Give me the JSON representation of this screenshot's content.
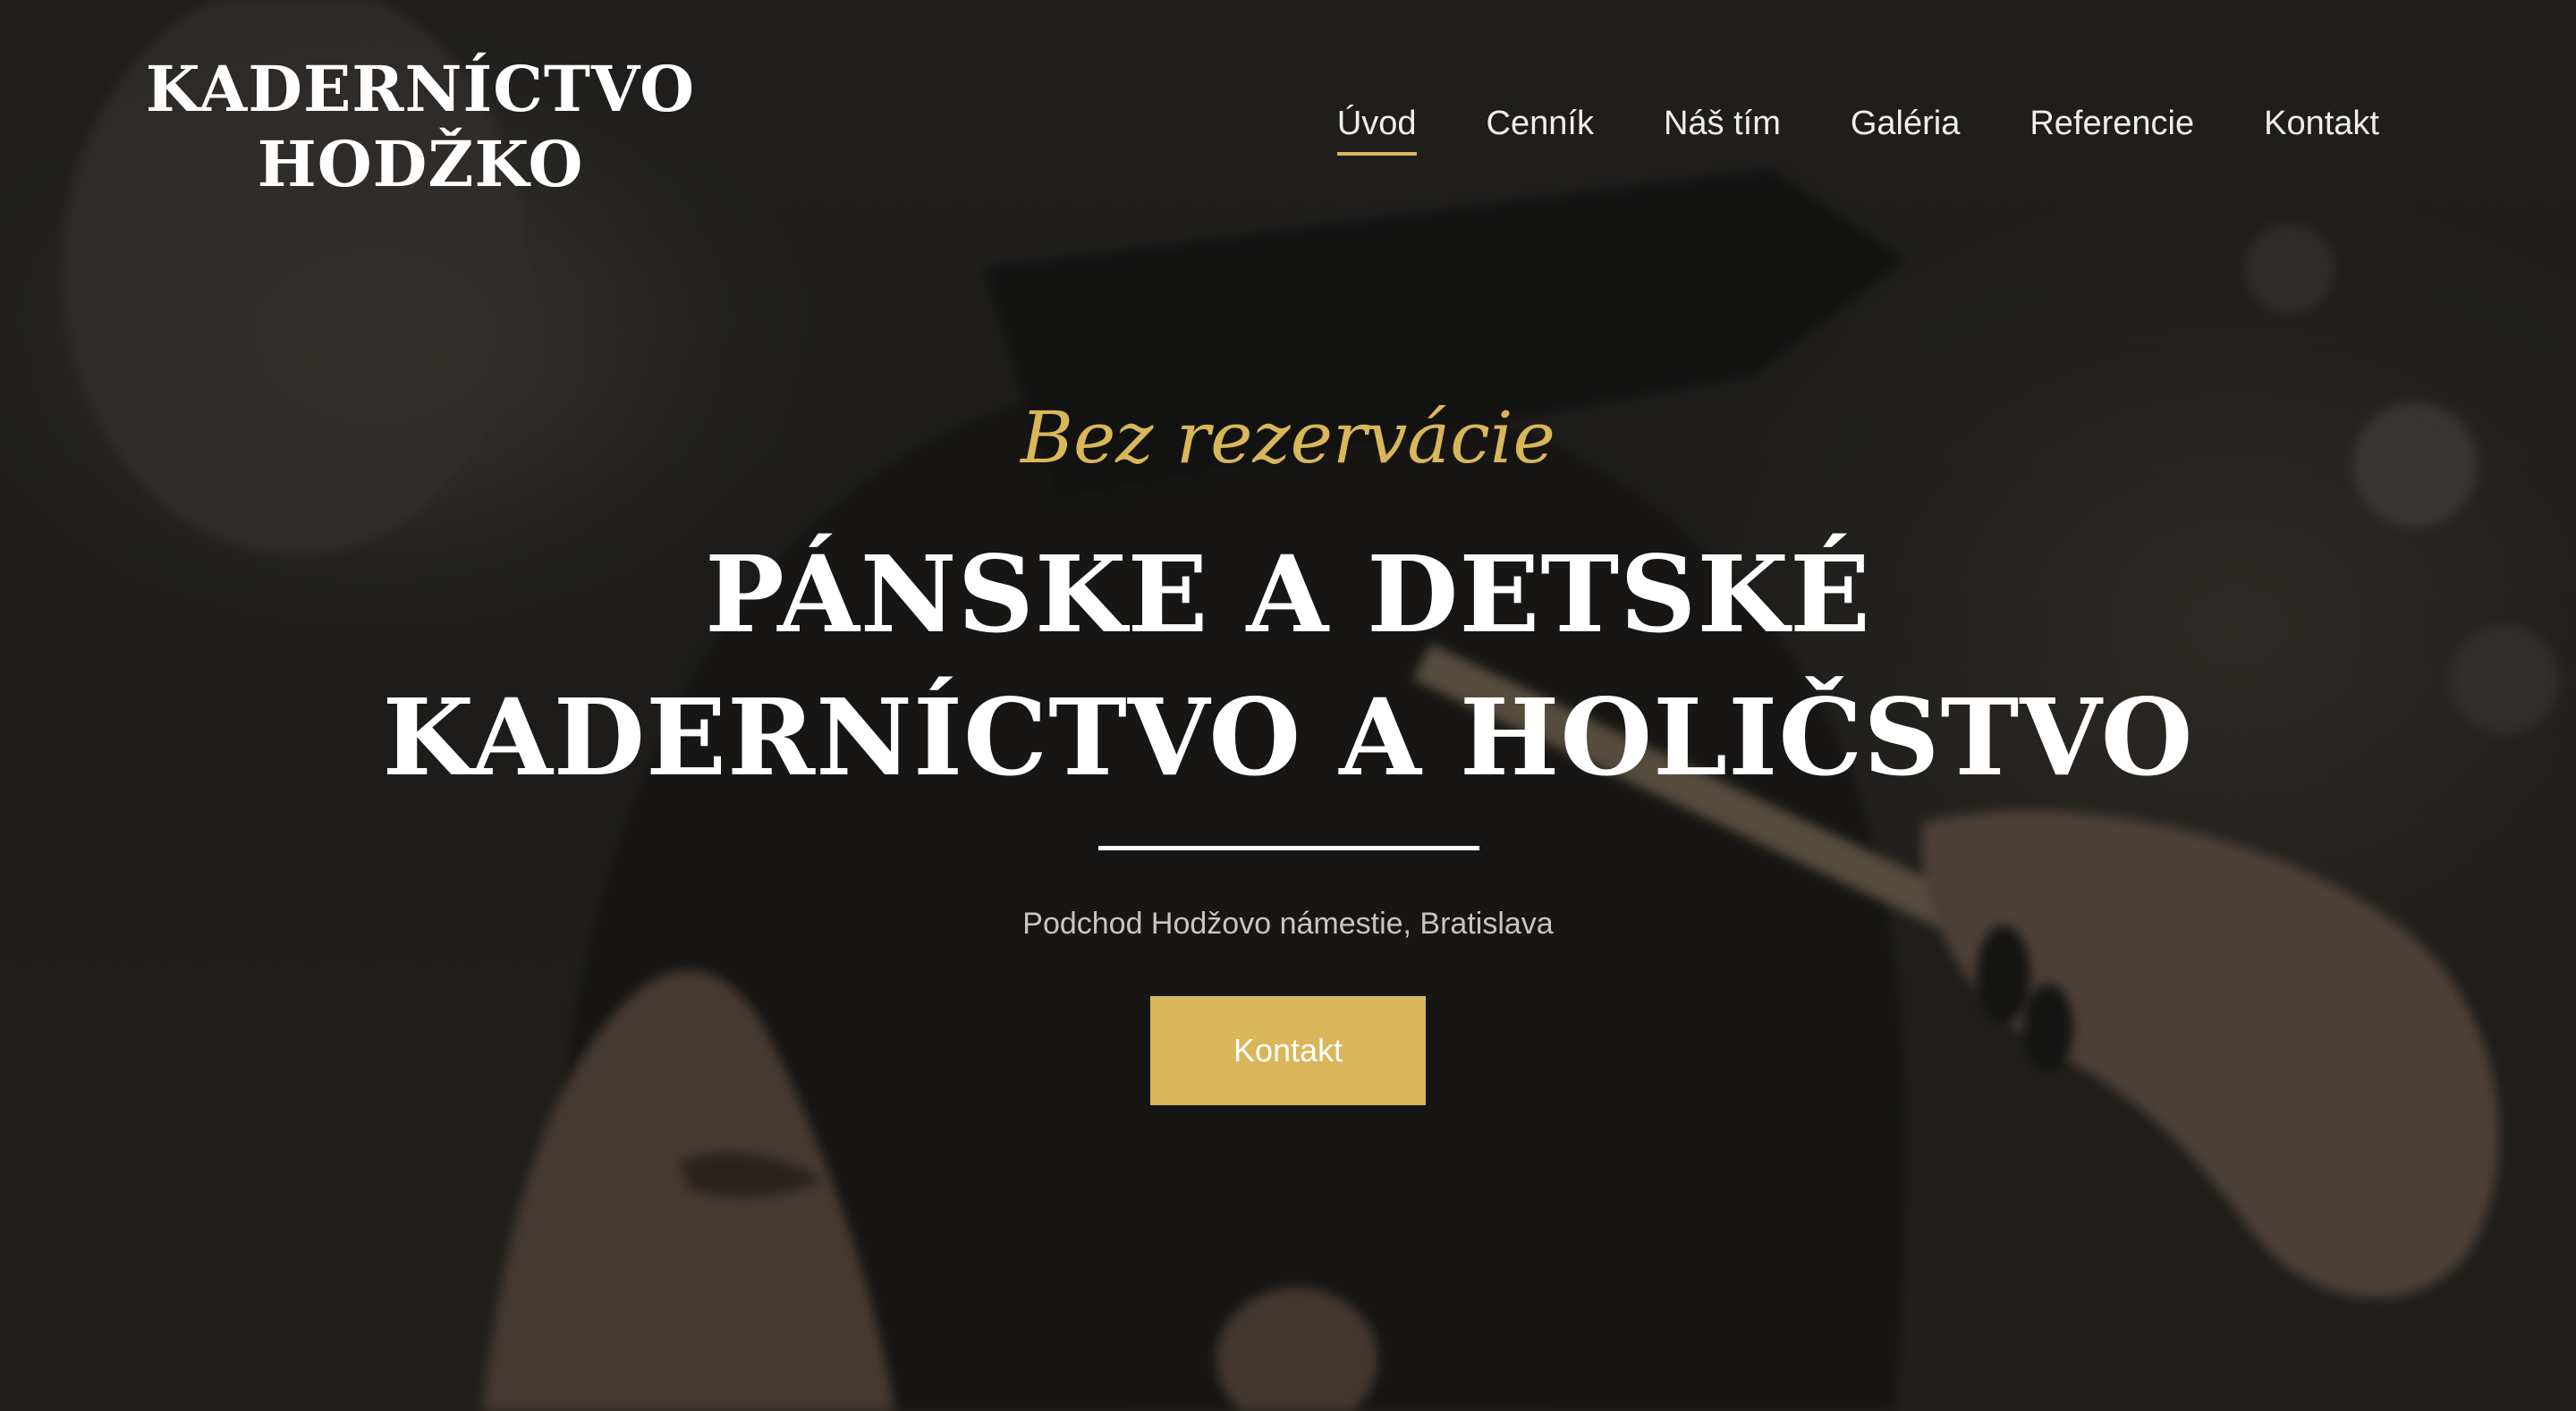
{
  "brand": {
    "logo_line1": "KADERNÍCTVO",
    "logo_line2": "HODŽKO"
  },
  "nav": {
    "items": [
      {
        "label": "Úvod",
        "active": true
      },
      {
        "label": "Cenník",
        "active": false
      },
      {
        "label": "Náš tím",
        "active": false
      },
      {
        "label": "Galéria",
        "active": false
      },
      {
        "label": "Referencie",
        "active": false
      },
      {
        "label": "Kontakt",
        "active": false
      }
    ]
  },
  "hero": {
    "tagline": "Bez rezervácie",
    "headline_line1": "PÁNSKE A DETSKÉ",
    "headline_line2": "KADERNÍCTVO A HOLIČSTVO",
    "address": "Podchod Hodžovo námestie, Bratislava",
    "cta_label": "Kontakt",
    "background_image": "barber-cutting-hair-photo"
  },
  "colors": {
    "accent": "#d9b65a",
    "text_light": "#ffffff",
    "text_muted": "#c9c6c0",
    "overlay": "#141312"
  }
}
